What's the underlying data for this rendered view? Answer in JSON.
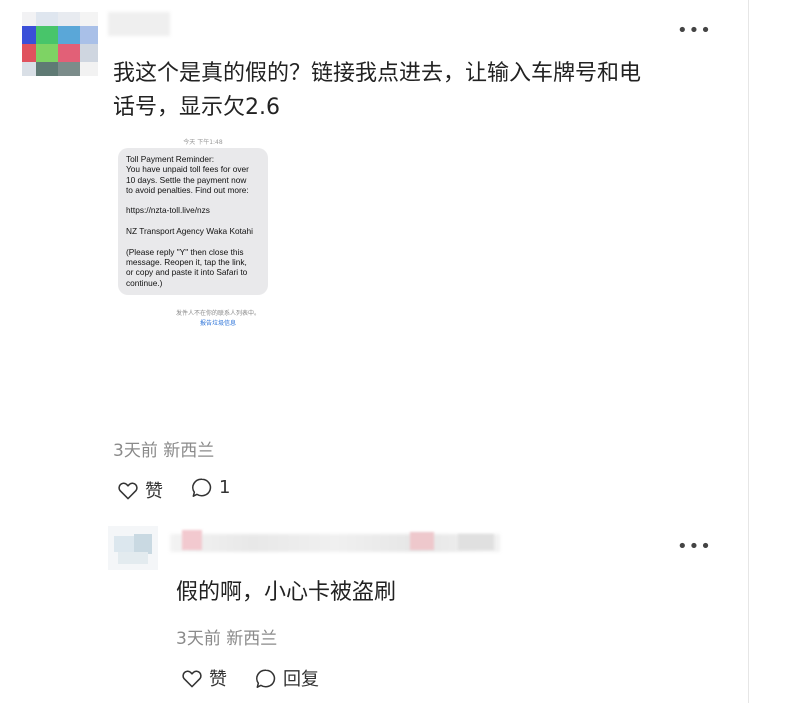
{
  "post": {
    "text_line1": "我这个是真的假的？链接我点进去，让输入车牌号和电",
    "text_line2": "话号，显示欠2.6",
    "timestamp": "3天前",
    "location": "新西兰",
    "like_label": "赞",
    "comment_count": "1",
    "more_icon": "more-horizontal-icon"
  },
  "screenshot": {
    "time": "今天 下午1:48",
    "sms_lines": [
      "Toll Payment Reminder:",
      "You have unpaid toll fees for over",
      "10 days. Settle the payment now",
      "to avoid penalties. Find out more:",
      "",
      "https://nzta-toll.live/nzs",
      "",
      "NZ Transport Agency Waka Kotahi",
      "",
      "(Please reply \"Y\" then close this",
      "message. Reopen it, tap the link,",
      "or copy and paste it into Safari to",
      "continue.)"
    ],
    "footer_note": "发件人不在你的联系人列表中。",
    "footer_link": "报告垃圾信息"
  },
  "reply": {
    "text": "假的啊，小心卡被盗刷",
    "timestamp": "3天前",
    "location": "新西兰",
    "like_label": "赞",
    "reply_label": "回复"
  },
  "colors": {
    "meta_gray": "#8a8a8a",
    "bubble_gray": "#e9e9eb",
    "link_blue": "#2a72d8"
  }
}
